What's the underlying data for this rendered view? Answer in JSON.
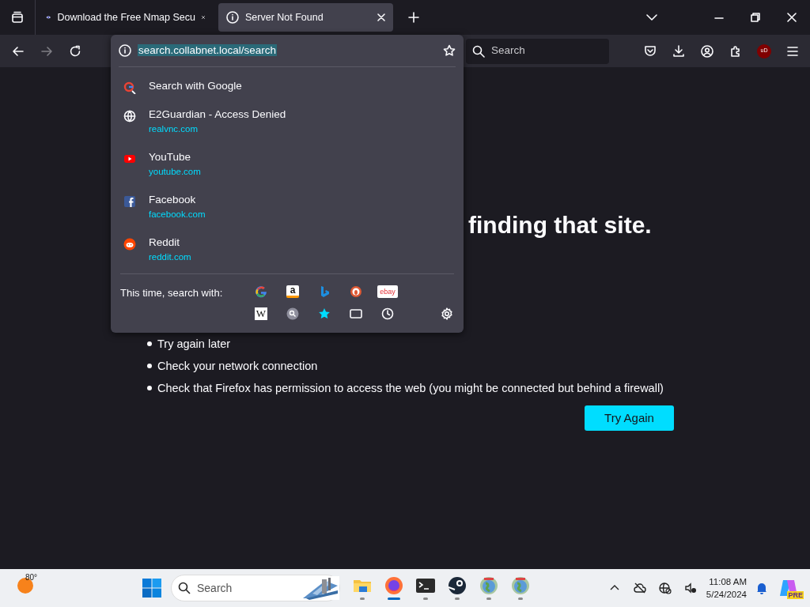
{
  "tabs": [
    {
      "kind": "nmap",
      "title": "Download the Free Nmap Secu",
      "selected": false
    },
    {
      "kind": "info",
      "title": "Server Not Found",
      "selected": true
    }
  ],
  "nav": [
    {
      "kind": "back",
      "disabled": false
    },
    {
      "kind": "forward",
      "disabled": true
    },
    {
      "kind": "reload",
      "disabled": false
    }
  ],
  "url_bar": {
    "value": "search.collabnet.local/search",
    "text_selected": true
  },
  "search": {
    "placeholder": "Search"
  },
  "extension_badge": "uD",
  "suggestions": [
    {
      "kind": "search",
      "title": "Search with Google"
    },
    {
      "kind": "globe",
      "title": "E2Guardian - Access Denied",
      "url": "realvnc.com"
    },
    {
      "kind": "youtube",
      "title": "YouTube",
      "url": "youtube.com"
    },
    {
      "kind": "facebook",
      "title": "Facebook",
      "url": "facebook.com"
    },
    {
      "kind": "reddit",
      "title": "Reddit",
      "url": "reddit.com"
    }
  ],
  "search_with": {
    "label": "This time, search with:",
    "engines": [
      {
        "kind": "google"
      },
      {
        "kind": "amazon",
        "glyph": "a"
      },
      {
        "kind": "bing"
      },
      {
        "kind": "duckduckgo"
      },
      {
        "kind": "ebay",
        "glyph": "ebay"
      },
      {
        "kind": "wikipedia",
        "glyph": "W"
      },
      {
        "kind": "search"
      },
      {
        "kind": "bookmarks"
      },
      {
        "kind": "tabs"
      },
      {
        "kind": "history"
      }
    ]
  },
  "error_page": {
    "heading": "finding that site.",
    "tips": [
      "Try again later",
      "Check your network connection",
      "Check that Firefox has permission to access the web (you might be connected but behind a firewall)"
    ],
    "button": "Try Again"
  },
  "taskbar": {
    "weather": "80°",
    "search_placeholder": "Search",
    "apps": [
      {
        "kind": "folder",
        "active": false
      },
      {
        "kind": "firefox",
        "active": true
      },
      {
        "kind": "terminal",
        "active": false
      },
      {
        "kind": "steam",
        "active": false
      },
      {
        "kind": "globe-app",
        "active": false
      },
      {
        "kind": "globe-app",
        "active": false
      }
    ],
    "time": "11:08 AM",
    "date": "5/24/2024",
    "copilot_badge": "PRE"
  }
}
